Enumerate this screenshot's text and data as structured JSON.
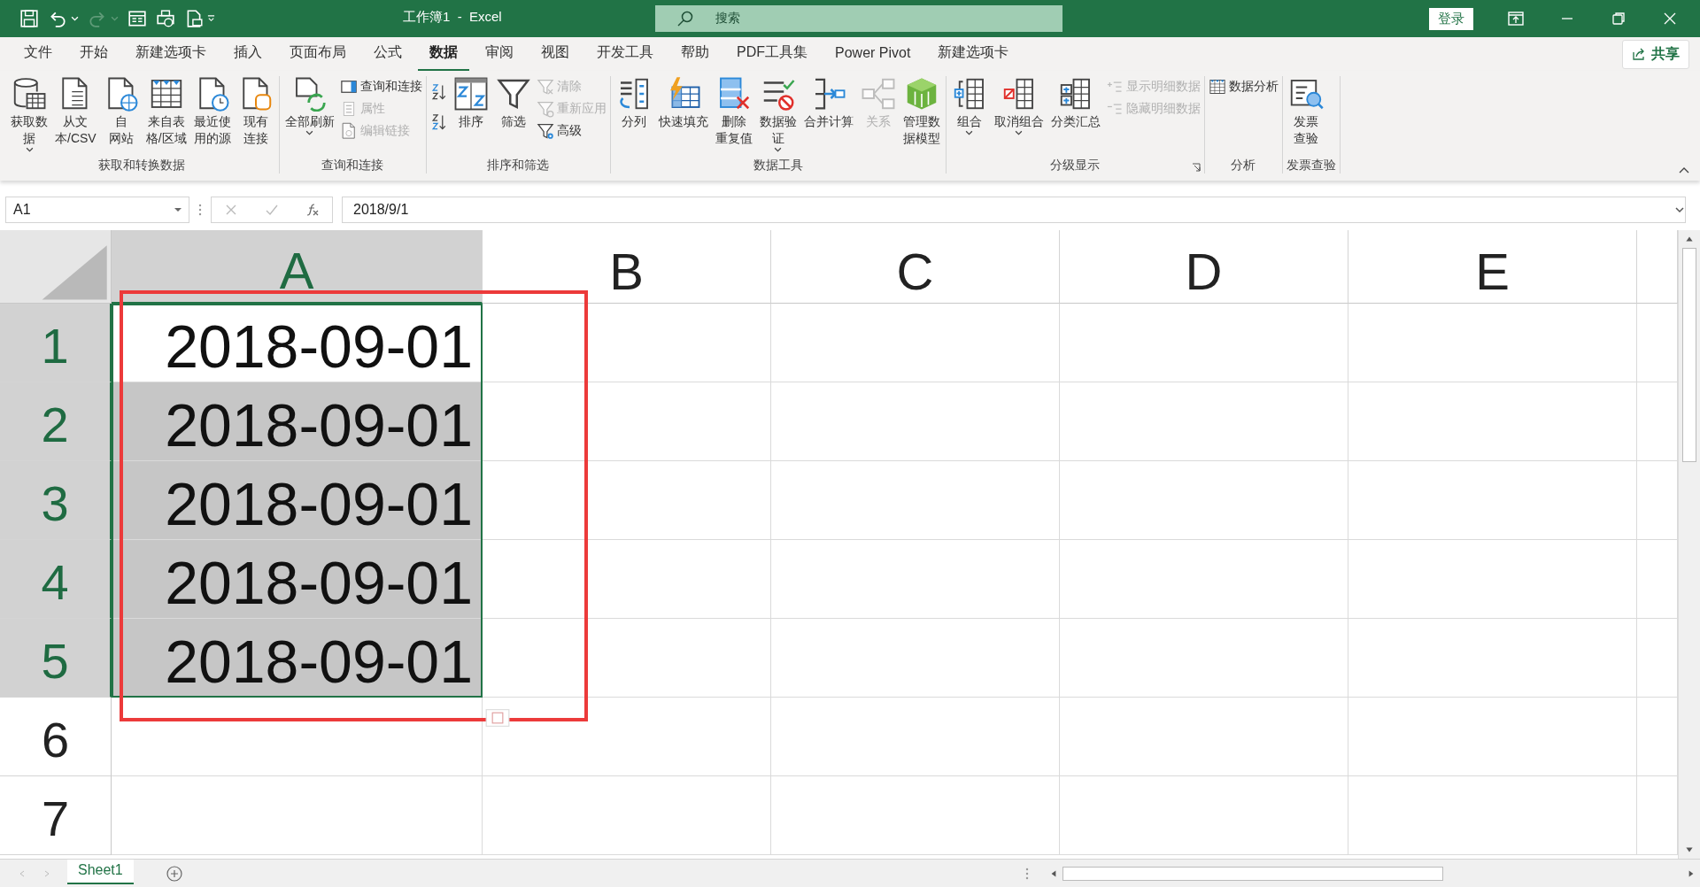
{
  "title_bar": {
    "title": "工作簿1  -  Excel",
    "search": {
      "placeholder": "搜索"
    },
    "sign_in": "登录"
  },
  "menu_tabs": [
    {
      "label": "文件",
      "selected": false
    },
    {
      "label": "开始",
      "selected": false
    },
    {
      "label": "新建选项卡",
      "selected": false
    },
    {
      "label": "插入",
      "selected": false
    },
    {
      "label": "页面布局",
      "selected": false
    },
    {
      "label": "公式",
      "selected": false
    },
    {
      "label": "数据",
      "selected": true
    },
    {
      "label": "审阅",
      "selected": false
    },
    {
      "label": "视图",
      "selected": false
    },
    {
      "label": "开发工具",
      "selected": false
    },
    {
      "label": "帮助",
      "selected": false
    },
    {
      "label": "PDF工具集",
      "selected": false
    },
    {
      "label": "Power Pivot",
      "selected": false
    },
    {
      "label": "新建选项卡",
      "selected": false
    }
  ],
  "share": "共享",
  "ribbon_groups": [
    {
      "label": "获取和转换数据",
      "items": [
        {
          "kind": "large",
          "label": "获取数据",
          "dropdown": true,
          "disabled": false
        },
        {
          "kind": "large",
          "label": "从文本/CSV",
          "disabled": false
        },
        {
          "kind": "large",
          "label": "自网站",
          "disabled": false
        },
        {
          "kind": "large",
          "label": "来自表格/区域",
          "disabled": false
        },
        {
          "kind": "large",
          "label": "最近使用的源",
          "disabled": false
        },
        {
          "kind": "large",
          "label": "现有连接",
          "disabled": false
        }
      ]
    },
    {
      "label": "查询和连接",
      "items": [
        {
          "kind": "large",
          "label": "全部刷新",
          "dropdown": true,
          "disabled": false
        },
        {
          "kind": "small",
          "label": "查询和连接",
          "disabled": false
        },
        {
          "kind": "small",
          "label": "属性",
          "disabled": true
        },
        {
          "kind": "small",
          "label": "编辑链接",
          "disabled": true
        }
      ]
    },
    {
      "label": "排序和筛选",
      "items": [
        {
          "kind": "icon",
          "disabled": false
        },
        {
          "kind": "icon",
          "disabled": false
        },
        {
          "kind": "large",
          "label": "排序",
          "disabled": false
        },
        {
          "kind": "large",
          "label": "筛选",
          "disabled": false
        },
        {
          "kind": "small",
          "label": "清除",
          "disabled": true
        },
        {
          "kind": "small",
          "label": "重新应用",
          "disabled": true
        },
        {
          "kind": "small",
          "label": "高级",
          "disabled": false
        }
      ]
    },
    {
      "label": "数据工具",
      "items": [
        {
          "kind": "large",
          "label": "分列",
          "disabled": false
        },
        {
          "kind": "large",
          "label": "快速填充",
          "disabled": false
        },
        {
          "kind": "large",
          "label": "删除重复值",
          "disabled": false
        },
        {
          "kind": "large",
          "label": "数据验证",
          "dropdown": true,
          "disabled": false
        },
        {
          "kind": "large",
          "label": "合并计算",
          "disabled": false
        },
        {
          "kind": "large",
          "label": "关系",
          "disabled": true
        },
        {
          "kind": "large",
          "label": "管理数据模型",
          "disabled": false
        }
      ]
    },
    {
      "label": "分级显示",
      "launcher": true,
      "items": [
        {
          "kind": "large",
          "label": "组合",
          "dropdown": true,
          "disabled": false
        },
        {
          "kind": "large",
          "label": "取消组合",
          "dropdown": true,
          "disabled": false
        },
        {
          "kind": "large",
          "label": "分类汇总",
          "disabled": false
        },
        {
          "kind": "small",
          "label": "显示明细数据",
          "disabled": true
        },
        {
          "kind": "small",
          "label": "隐藏明细数据",
          "disabled": true
        }
      ]
    },
    {
      "label": "分析",
      "items": [
        {
          "kind": "small",
          "label": "数据分析",
          "disabled": false
        }
      ]
    },
    {
      "label": "发票查验",
      "items": [
        {
          "kind": "large",
          "label": "发票查验",
          "disabled": false
        }
      ]
    }
  ],
  "formula_bar": {
    "name_box": "A1",
    "formula": "2018/9/1"
  },
  "sheet": {
    "columns": [
      {
        "label": "A",
        "selected": true
      },
      {
        "label": "B",
        "selected": false
      },
      {
        "label": "C",
        "selected": false
      },
      {
        "label": "D",
        "selected": false
      },
      {
        "label": "E",
        "selected": false
      }
    ],
    "rows": [
      {
        "label": "1",
        "selected": true,
        "cells": [
          {
            "value": "2018-09-01",
            "selected": false
          }
        ]
      },
      {
        "label": "2",
        "selected": true,
        "cells": [
          {
            "value": "2018-09-01",
            "selected": true
          }
        ]
      },
      {
        "label": "3",
        "selected": true,
        "cells": [
          {
            "value": "2018-09-01",
            "selected": true
          }
        ]
      },
      {
        "label": "4",
        "selected": true,
        "cells": [
          {
            "value": "2018-09-01",
            "selected": true
          }
        ]
      },
      {
        "label": "5",
        "selected": true,
        "cells": [
          {
            "value": "2018-09-01",
            "selected": true
          }
        ]
      },
      {
        "label": "6",
        "selected": false,
        "cells": []
      },
      {
        "label": "7",
        "selected": false,
        "cells": []
      }
    ]
  },
  "sheet_tabs": [
    {
      "label": "Sheet1",
      "selected": true
    }
  ]
}
